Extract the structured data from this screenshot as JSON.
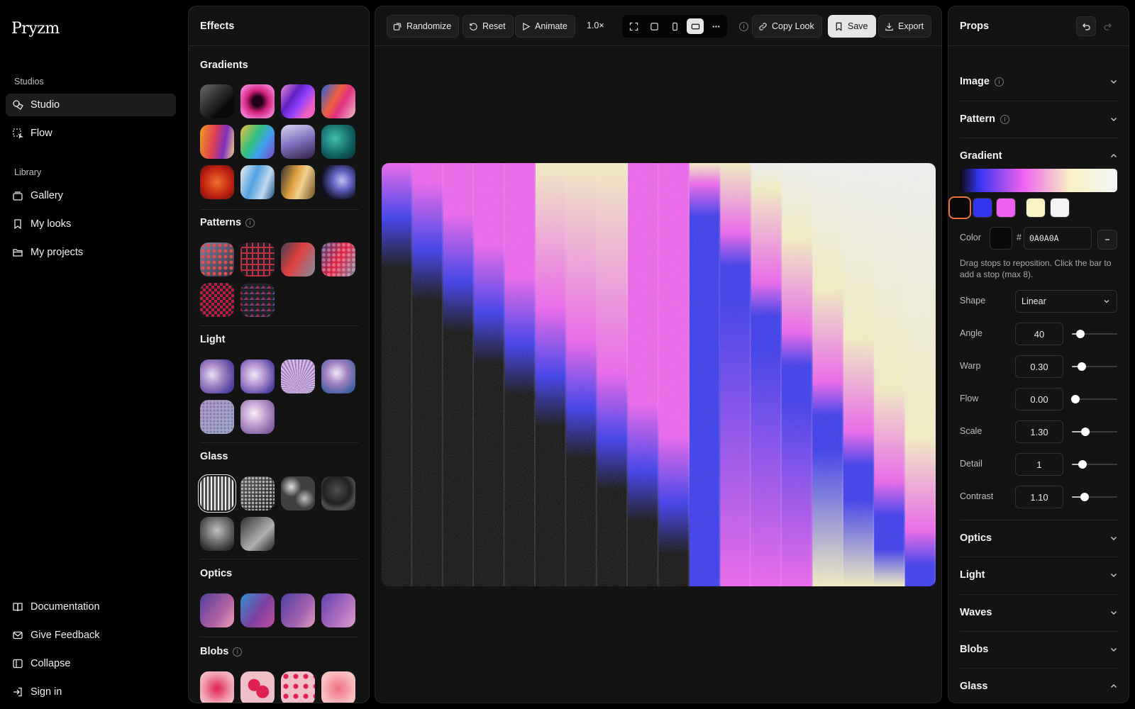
{
  "app": {
    "logo": "Pryzm",
    "nav": {
      "studios_label": "Studios",
      "library_label": "Library",
      "items": [
        {
          "label": "Studio",
          "icon": "swatch-icon"
        },
        {
          "label": "Flow",
          "icon": "flow-icon"
        },
        {
          "label": "Gallery",
          "icon": "gallery-icon"
        },
        {
          "label": "My looks",
          "icon": "bookmark-icon"
        },
        {
          "label": "My projects",
          "icon": "folder-icon"
        }
      ],
      "footer": [
        {
          "label": "Documentation",
          "icon": "book-icon"
        },
        {
          "label": "Give Feedback",
          "icon": "mail-icon"
        },
        {
          "label": "Collapse",
          "icon": "collapse-icon"
        },
        {
          "label": "Sign in",
          "icon": "sign-in-icon"
        }
      ]
    }
  },
  "effects": {
    "title": "Effects",
    "sections": {
      "gradients": "Gradients",
      "patterns": "Patterns",
      "light": "Light",
      "glass": "Glass",
      "optics": "Optics",
      "blobs": "Blobs"
    }
  },
  "toolbar": {
    "randomize": "Randomize",
    "reset": "Reset",
    "animate": "Animate",
    "zoom": "1.0×",
    "copy_look": "Copy Look",
    "save": "Save",
    "export": "Export",
    "active_ratio": "landscape"
  },
  "props": {
    "title": "Props",
    "sections": {
      "image": "Image",
      "pattern": "Pattern",
      "gradient": "Gradient",
      "optics": "Optics",
      "light": "Light",
      "waves": "Waves",
      "blobs": "Blobs",
      "glass": "Glass"
    },
    "gradient": {
      "stops": [
        "#0a0a0a",
        "#3535f0",
        "#f060f0",
        "#f8f2c4",
        "#f4f4f4"
      ],
      "selected_stop": 0,
      "color_label": "Color",
      "hash": "#",
      "hex": "0A0A0A",
      "hint": "Drag stops to reposition. Click the bar to add a stop (max 8).",
      "shape_label": "Shape",
      "shape": "Linear",
      "params": {
        "angle": {
          "label": "Angle",
          "value": "40",
          "level": 0.18
        },
        "warp": {
          "label": "Warp",
          "value": "0.30",
          "level": 0.22
        },
        "flow": {
          "label": "Flow",
          "value": "0.00",
          "level": 0.0
        },
        "scale": {
          "label": "Scale",
          "value": "1.30",
          "level": 0.29
        },
        "detail": {
          "label": "Detail",
          "value": "1",
          "level": 0.24
        },
        "contrast": {
          "label": "Contrast",
          "value": "1.10",
          "level": 0.28
        }
      }
    }
  }
}
